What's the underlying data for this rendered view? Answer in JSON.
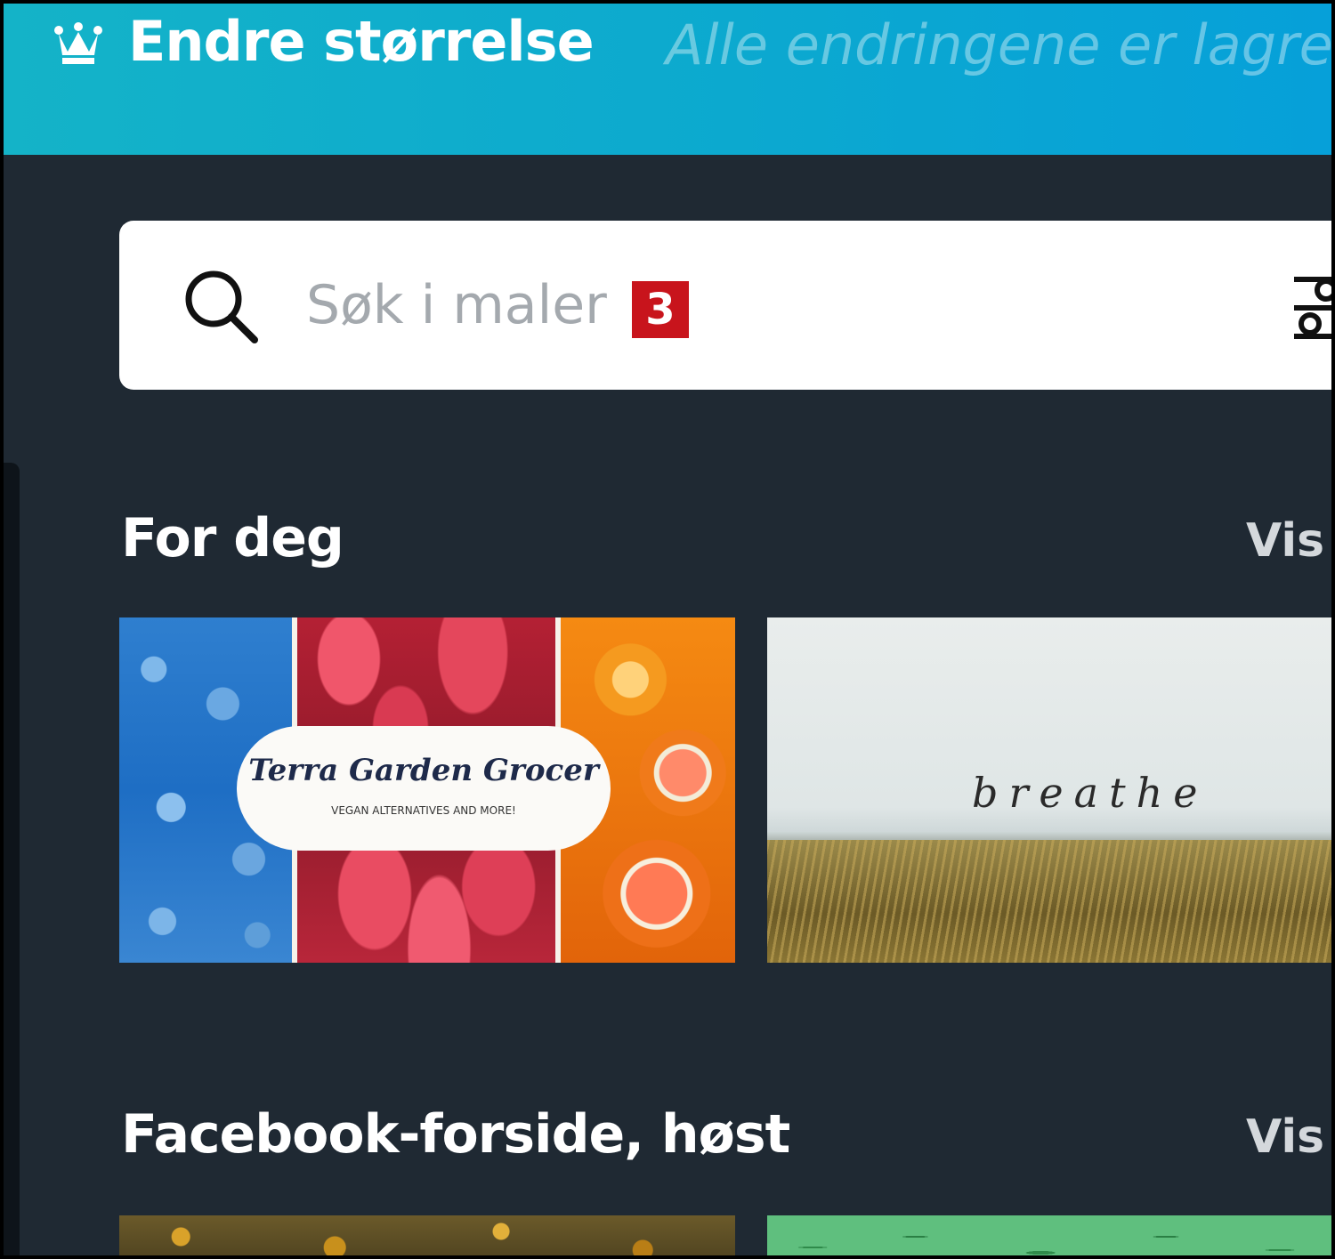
{
  "topbar": {
    "title": "Endre størrelse",
    "status": "Alle endringene er lagret",
    "crown_icon": "crown-icon"
  },
  "search": {
    "placeholder": "Søk i maler",
    "badge": "3",
    "search_icon": "search-icon",
    "filter_icon": "filter-sliders-icon"
  },
  "sections": [
    {
      "title": "For deg",
      "see_all": "Vis",
      "cards": [
        {
          "title": "Terra Garden Grocer",
          "subtitle": "VEGAN ALTERNATIVES AND MORE!"
        },
        {
          "title": "breathe"
        }
      ]
    },
    {
      "title": "Facebook-forside, høst",
      "see_all": "Vis",
      "cards": [
        {},
        {}
      ]
    }
  ],
  "colors": {
    "topbar_start": "#14b3c8",
    "topbar_end": "#06a0d9",
    "background": "#1f2933",
    "badge": "#c8141c"
  }
}
